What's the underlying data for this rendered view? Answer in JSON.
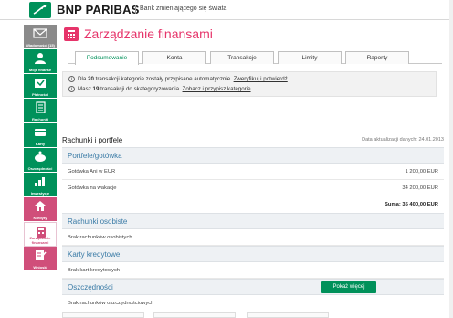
{
  "header": {
    "brand": "BNP PARIBAS",
    "tagline": "Bank zmieniającego się świata"
  },
  "sidebar": {
    "items": [
      {
        "label": "Wiadomości (15)",
        "icon": "envelope-icon"
      },
      {
        "label": "Moje finanse",
        "icon": "person-icon"
      },
      {
        "label": "Płatności",
        "icon": "payment-icon"
      },
      {
        "label": "Rachunki",
        "icon": "document-icon"
      },
      {
        "label": "Karty",
        "icon": "card-icon"
      },
      {
        "label": "Oszczędności",
        "icon": "piggy-bank-icon"
      },
      {
        "label": "Inwestycje",
        "icon": "chart-icon"
      },
      {
        "label": "Kredyty",
        "icon": "house-icon"
      },
      {
        "label": "Zarządzanie finansami",
        "icon": "calculator-icon"
      },
      {
        "label": "Wnioski",
        "icon": "form-icon"
      }
    ]
  },
  "page": {
    "title": "Zarządzanie finansami"
  },
  "tabs": [
    "Podsumowanie",
    "Konta",
    "Transakcje",
    "Limity",
    "Raporty"
  ],
  "notice": {
    "line1_pre": "Dla ",
    "line1_count": "20",
    "line1_mid": " transakcji kategorie zostały przypisane automatycznie. ",
    "line1_link": "Zweryfikuj i potwierdź",
    "line2_pre": "Masz ",
    "line2_count": "19",
    "line2_mid": " transakcji do skategoryzowania. ",
    "line2_link": "Zobacz i przypisz kategorie"
  },
  "accounts": {
    "heading": "Rachunki i portfele",
    "updated": "Data aktualizacji danych: 24.01.2013",
    "groups": {
      "wallet": "Portfele/gotówka",
      "personal": "Rachunki osobiste",
      "cards": "Karty kredytowe",
      "savings": "Oszczędności"
    },
    "wallet_rows": [
      {
        "name": "Gotówka Ani w EUR",
        "amount": "1 200,00 EUR"
      },
      {
        "name": "Gotówka na wakacje",
        "amount": "34 200,00 EUR"
      }
    ],
    "wallet_sum": "Suma: 35 400,00 EUR",
    "personal_empty": "Brak rachunków osobistych",
    "cards_empty": "Brak kart kredytowych",
    "savings_empty": "Brak rachunków oszczędnościowych"
  },
  "buttons": {
    "show_more": "Pokaż więcej"
  },
  "colors": {
    "brand_green": "#00915a",
    "accent_pink": "#e6346a",
    "group_blue": "#3a7ba6"
  }
}
